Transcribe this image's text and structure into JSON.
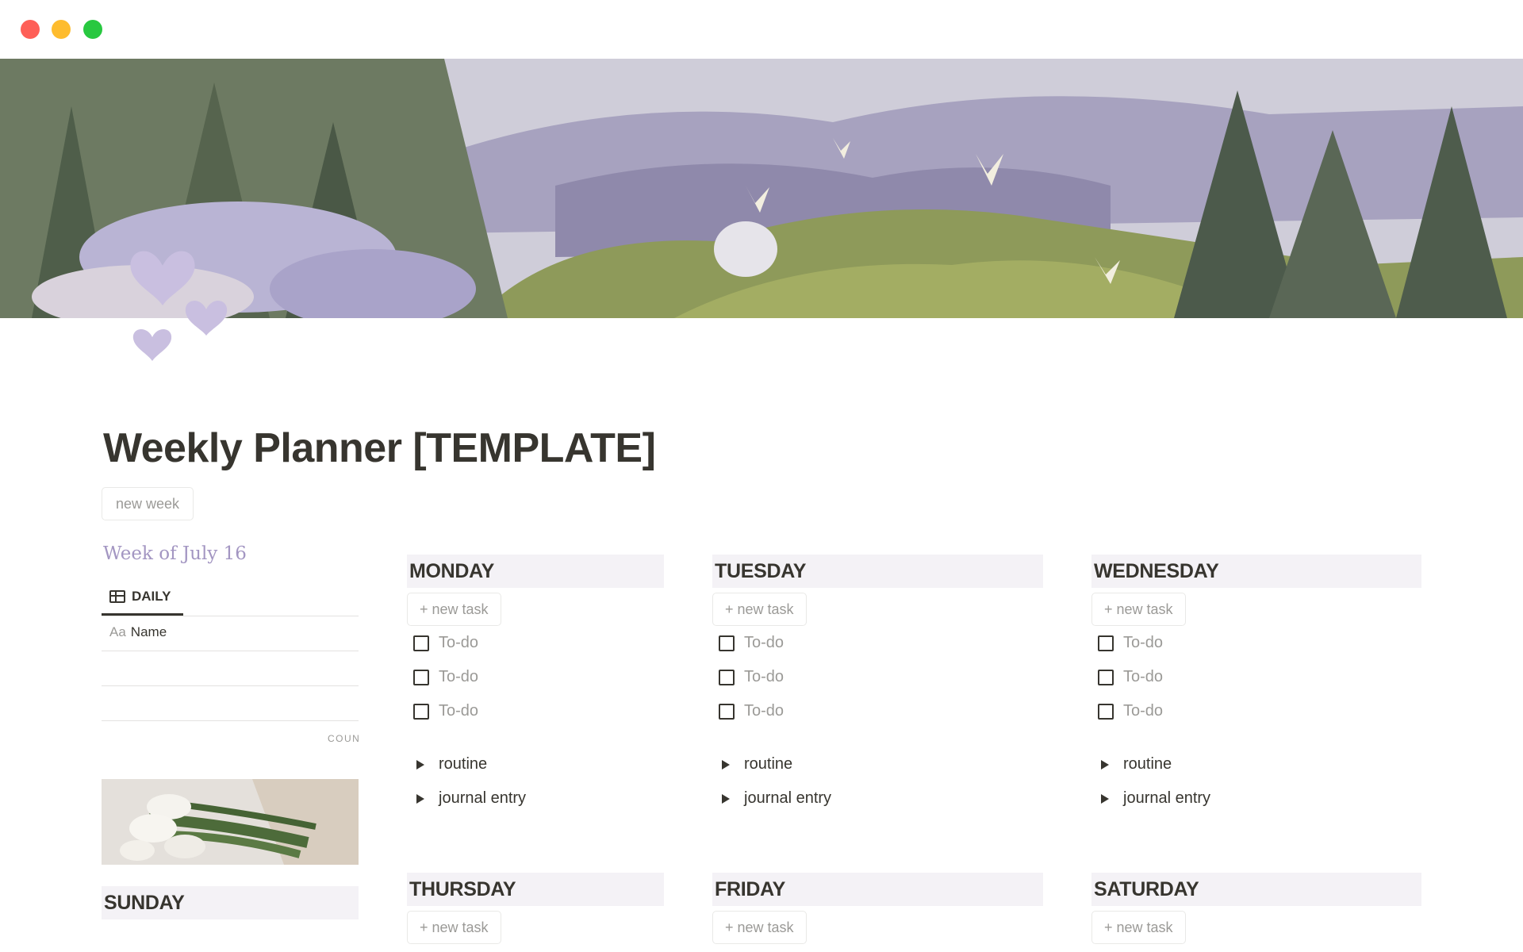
{
  "page": {
    "title": "Weekly Planner [TEMPLATE]",
    "new_week_button": "new week"
  },
  "sidebar": {
    "week_heading": "Week of July 16",
    "view_tab": "DAILY",
    "view_icon": "table-icon",
    "column_header_prefix": "Aa",
    "column_header": "Name",
    "count_label": "COUNT",
    "sunday_title": "SUNDAY"
  },
  "days": [
    {
      "title": "MONDAY",
      "new_task": "+ new task",
      "todos": [
        "To-do",
        "To-do",
        "To-do"
      ],
      "toggles": [
        "routine",
        "journal entry"
      ]
    },
    {
      "title": "TUESDAY",
      "new_task": "+ new task",
      "todos": [
        "To-do",
        "To-do",
        "To-do"
      ],
      "toggles": [
        "routine",
        "journal entry"
      ]
    },
    {
      "title": "WEDNESDAY",
      "new_task": "+ new task",
      "todos": [
        "To-do",
        "To-do",
        "To-do"
      ],
      "toggles": [
        "routine",
        "journal entry"
      ]
    },
    {
      "title": "THURSDAY",
      "new_task": "+ new task"
    },
    {
      "title": "FRIDAY",
      "new_task": "+ new task"
    },
    {
      "title": "SATURDAY",
      "new_task": "+ new task"
    }
  ],
  "colors": {
    "accent_lavender": "#a396c2",
    "heart": "#c9bfe0",
    "day_header_bg": "#f4f2f6"
  }
}
